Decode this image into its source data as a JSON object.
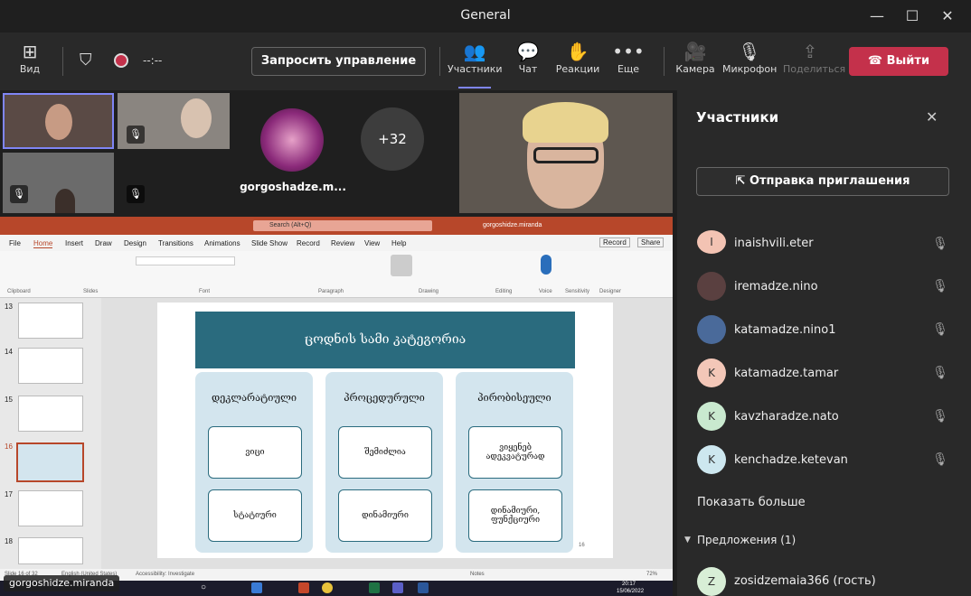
{
  "window": {
    "title": "General"
  },
  "toolbar": {
    "view_label": "Вид",
    "timer": "--:--",
    "request_control": "Запросить управление",
    "participants": "Участники",
    "chat": "Чат",
    "reactions": "Реакции",
    "more": "Еще",
    "camera": "Камера",
    "mic": "Микрофон",
    "share": "Поделиться",
    "leave": "Выйти"
  },
  "gallery": {
    "extra_count": "+32",
    "tile_name": "gorgoshadze.m..."
  },
  "panel": {
    "title": "Участники",
    "invite": "Отправка приглашения",
    "people": [
      {
        "name": "inaishvili.eter",
        "initial": ""
      },
      {
        "name": "iremadze.nino",
        "initial": ""
      },
      {
        "name": "katamadze.nino1",
        "initial": ""
      },
      {
        "name": "katamadze.tamar",
        "initial": "K"
      },
      {
        "name": "kavzharadze.nato",
        "initial": "K"
      },
      {
        "name": "kenchadze.ketevan",
        "initial": "K"
      }
    ],
    "show_more": "Показать больше",
    "suggestions": "Предложения (1)",
    "suggested": {
      "name": "zosidzemaia366 (гость)",
      "initial": "Z"
    }
  },
  "ppt": {
    "search": "Search (Alt+Q)",
    "user": "gorgoshidze.miranda",
    "tabs": [
      "File",
      "Home",
      "Insert",
      "Draw",
      "Design",
      "Transitions",
      "Animations",
      "Slide Show",
      "Record",
      "Review",
      "View",
      "Help"
    ],
    "record_btn": "Record",
    "share_btn": "Share",
    "groups": [
      "Clipboard",
      "Slides",
      "Font",
      "Paragraph",
      "Drawing",
      "Editing",
      "Voice",
      "Sensitivity",
      "Designer"
    ],
    "slide_numbers": [
      "13",
      "14",
      "15",
      "16",
      "17",
      "18"
    ],
    "slide_title": "ცოდნის სამი კატეგორია",
    "columns": [
      {
        "head": "დეკლარატიული",
        "top": "ვიცი",
        "bottom": "სტატიური"
      },
      {
        "head": "პროცედურული",
        "top": "შემიძლია",
        "bottom": "დინამიური"
      },
      {
        "head": "პირობისეული",
        "top": "ვიყენებ ადეკვატურად",
        "bottom": "დინამიური, ფუნქციური"
      }
    ],
    "slide_page": "16",
    "status_left": "Slide 16 of 32",
    "status_lang": "English (United States)",
    "status_access": "Accessibility: Investigate",
    "notes": "Notes",
    "zoom": "72%",
    "clock_time": "20:17",
    "clock_date": "15/06/2022"
  },
  "nametag": "gorgoshidze.miranda"
}
